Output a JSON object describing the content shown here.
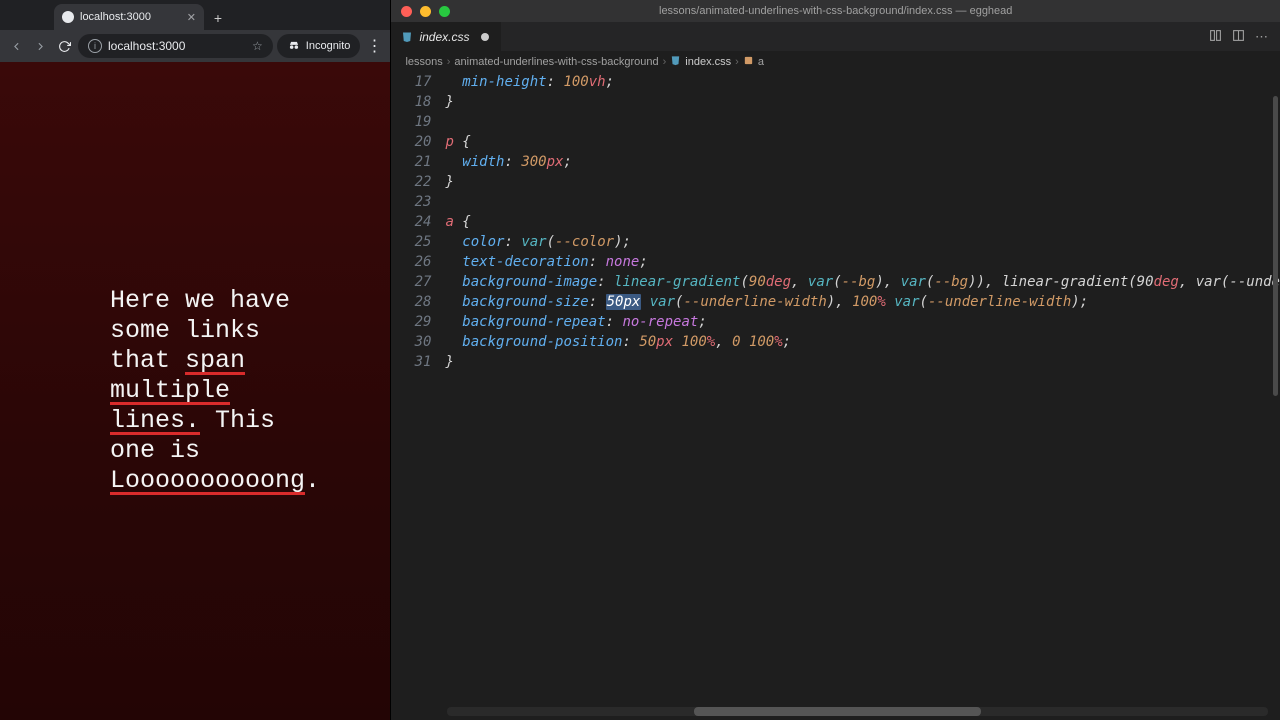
{
  "browser": {
    "tab_title": "localhost:3000",
    "url": "localhost:3000",
    "incognito_label": "Incognito",
    "text_before_link1": "Here we have some links that ",
    "link1": "span multiple lines.",
    "text_mid": " This one is ",
    "link2": "Loooooooooong",
    "text_after": "."
  },
  "editor": {
    "window_title": "lessons/animated-underlines-with-css-background/index.css — egghead",
    "tab_label": "index.css",
    "breadcrumb": {
      "folder1": "lessons",
      "folder2": "animated-underlines-with-css-background",
      "file": "index.css",
      "symbol": "a"
    },
    "lines": {
      "17": {
        "prop": "min-height",
        "val": "100",
        "unit": "vh"
      },
      "18": {
        "raw": "}"
      },
      "19": {
        "raw": ""
      },
      "20": {
        "sel": "p",
        "open": " {"
      },
      "21": {
        "prop": "width",
        "val": "300",
        "unit": "px"
      },
      "22": {
        "raw": "}"
      },
      "23": {
        "raw": ""
      },
      "24": {
        "sel": "a",
        "open": " {"
      },
      "25": {
        "prop": "color",
        "fn": "var",
        "arg": "--color"
      },
      "26": {
        "prop": "text-decoration",
        "kw": "none"
      },
      "27": {
        "prop": "background-image",
        "grad_fn": "linear-gradient",
        "deg1": "90",
        "deg_unit": "deg",
        "varfn": "var",
        "bg": "--bg",
        "tail": ", linear-gradient(90",
        "tail2": ", var(--unde"
      },
      "28": {
        "prop": "background-size",
        "sel_val": "50",
        "sel_unit": "px",
        "varfn": "var",
        "uw": "--underline-width",
        "hundred": "100",
        "pct": "%"
      },
      "29": {
        "prop": "background-repeat",
        "kw": "no-repeat"
      },
      "30": {
        "prop": "background-position",
        "v1": "50",
        "u1": "px",
        "v2": "100",
        "u2": "%",
        "v3": "0",
        "v4": "100",
        "u4": "%"
      },
      "31": {
        "raw": "}"
      }
    },
    "line_numbers": [
      "17",
      "18",
      "19",
      "20",
      "21",
      "22",
      "23",
      "24",
      "25",
      "26",
      "27",
      "28",
      "29",
      "30",
      "31"
    ]
  }
}
